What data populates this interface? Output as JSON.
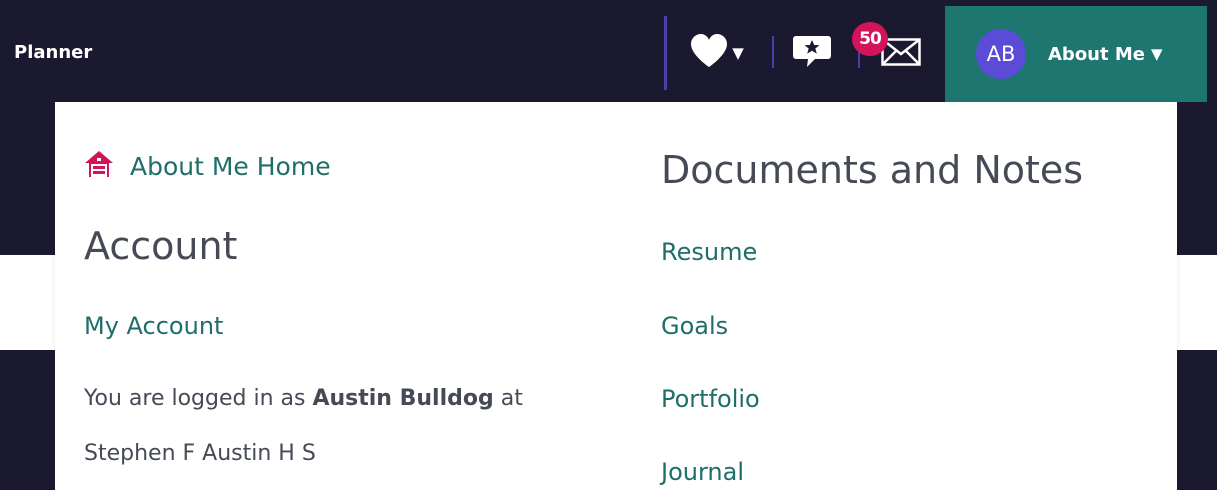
{
  "nav": {
    "brand": "Planner",
    "mail_badge_count": "50",
    "about_me": {
      "avatar_initials": "AB",
      "label": "About Me"
    },
    "icons": [
      "heart-icon",
      "chevron-down-icon",
      "chat-star-icon",
      "mail-icon"
    ]
  },
  "dropdown": {
    "home_link": "About Me Home",
    "account": {
      "heading": "Account",
      "my_account": "My Account",
      "login_prefix": "You are logged in as ",
      "user_name": "Austin Bulldog",
      "login_mid": " at",
      "school": "Stephen F Austin H S"
    },
    "documents": {
      "heading": "Documents and Notes",
      "items": [
        "Resume",
        "Goals",
        "Portfolio",
        "Journal"
      ]
    }
  },
  "colors": {
    "nav_bg": "#1a1930",
    "about_tab_bg": "#1e7670",
    "avatar_bg": "#5b4bd6",
    "badge_bg": "#d4145a",
    "link_color": "#1e6e6a",
    "heading_color": "#454a56",
    "home_icon_color": "#d4145a"
  }
}
